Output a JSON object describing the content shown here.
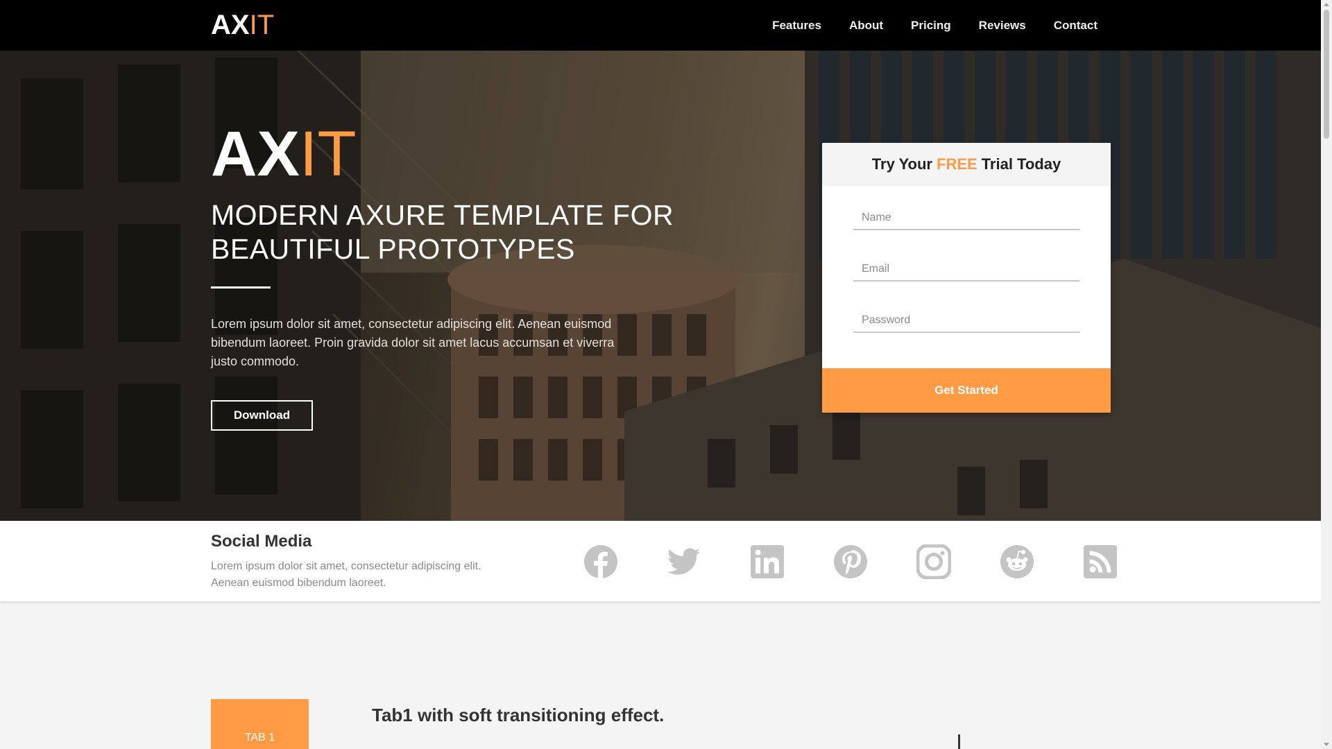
{
  "nav": {
    "logo_main": "AX",
    "logo_accent": "IT",
    "links": [
      "Features",
      "About",
      "Pricing",
      "Reviews",
      "Contact"
    ]
  },
  "hero": {
    "logo_main": "AX",
    "logo_accent": "IT",
    "title": "MODERN AXURE TEMPLATE FOR BEAUTIFUL PROTOTYPES",
    "text": "Lorem ipsum dolor sit amet, consectetur adipiscing elit. Aenean euismod bibendum laoreet. Proin gravida dolor sit amet lacus accumsan et viverra justo commodo.",
    "download_label": "Download"
  },
  "signup": {
    "heading_pre": "Try Your",
    "heading_accent": "FREE",
    "heading_post": "Trial Today",
    "name_placeholder": "Name",
    "email_placeholder": "Email",
    "password_placeholder": "Password",
    "submit_label": "Get Started"
  },
  "social": {
    "title": "Social Media",
    "text": "Lorem ipsum dolor sit amet, consectetur adipiscing elit. Aenean euismod bibendum laoreet.",
    "icons": [
      "facebook-icon",
      "twitter-icon",
      "linkedin-icon",
      "pinterest-icon",
      "instagram-icon",
      "reddit-icon",
      "rss-icon"
    ]
  },
  "tabs": {
    "tab1_label": "TAB 1",
    "tab1_heading": "Tab1 with soft transitioning effect."
  },
  "colors": {
    "accent": "#ff9a45",
    "nav_bg": "#000000",
    "icon_gray": "#c4c4c4"
  }
}
